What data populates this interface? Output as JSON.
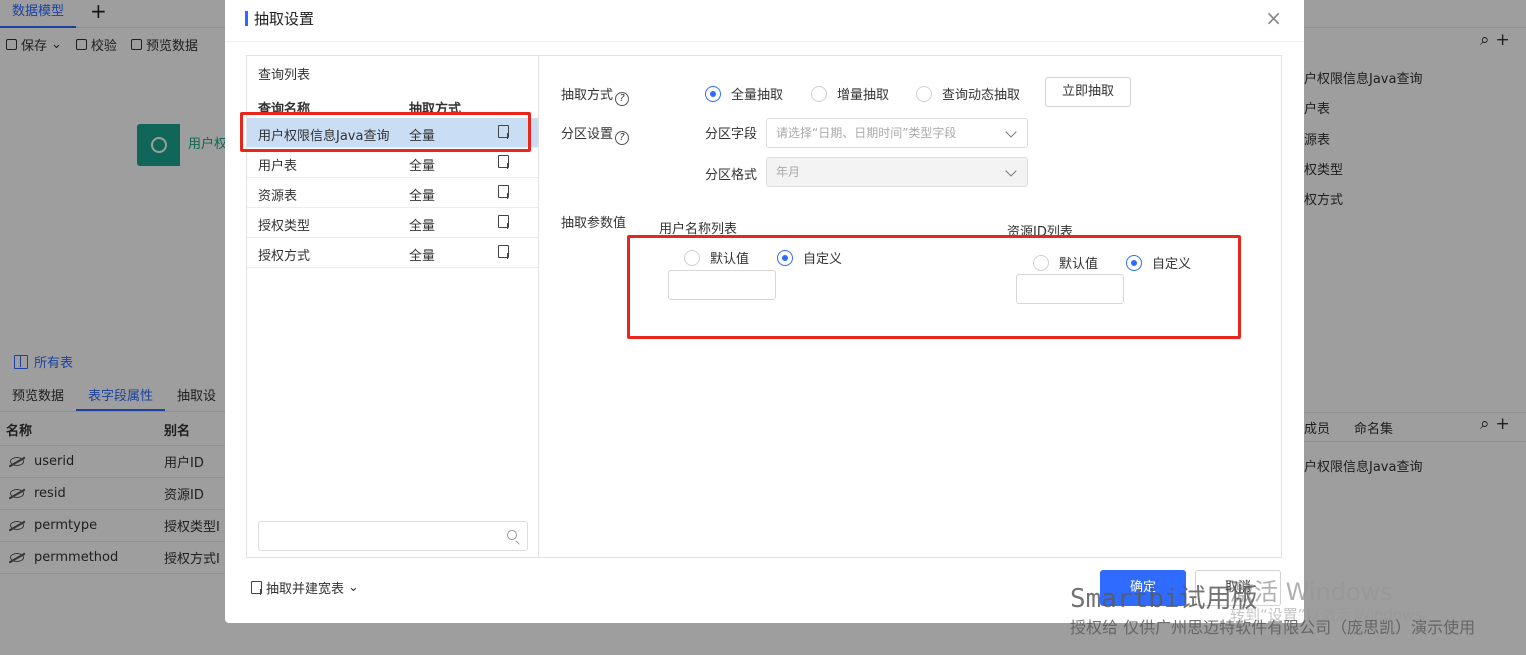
{
  "app": {
    "tab_active": "数据模型",
    "tab_add": "+",
    "toolbar": {
      "save": "保存",
      "validate": "校验",
      "preview": "预览数据"
    },
    "node_label": "用户权",
    "all_tables": "所有表",
    "bottom_tabs": [
      "预览数据",
      "表字段属性",
      "抽取设"
    ],
    "field_table": {
      "headers": [
        "名称",
        "别名"
      ],
      "rows": [
        {
          "name": "userid",
          "alias": "用户ID"
        },
        {
          "name": "resid",
          "alias": "资源ID"
        },
        {
          "name": "permtype",
          "alias": "授权类型I"
        },
        {
          "name": "permmethod",
          "alias": "授权方式I"
        }
      ]
    },
    "right_list": [
      "户权限信息Java查询",
      "户表",
      "源表",
      "权类型",
      "权方式"
    ],
    "right_tabs": [
      "成员",
      "命名集"
    ],
    "right_bottom_item": "户权限信息Java查询",
    "icons": {
      "search": "search-icon",
      "add": "plus-icon"
    }
  },
  "dialog": {
    "title": "抽取设置",
    "close": "×",
    "query_list": {
      "title": "查询列表",
      "headers": [
        "查询名称",
        "抽取方式"
      ],
      "rows": [
        {
          "name": "用户权限信息Java查询",
          "mode": "全量",
          "selected": true
        },
        {
          "name": "用户表",
          "mode": "全量"
        },
        {
          "name": "资源表",
          "mode": "全量"
        },
        {
          "name": "授权类型",
          "mode": "全量"
        },
        {
          "name": "授权方式",
          "mode": "全量"
        }
      ],
      "search_placeholder": ""
    },
    "settings": {
      "extract_mode_label": "抽取方式",
      "extract_modes": [
        "全量抽取",
        "增量抽取",
        "查询动态抽取"
      ],
      "extract_mode_selected": "全量抽取",
      "extract_now": "立即抽取",
      "partition_label": "分区设置",
      "partition_field_label": "分区字段",
      "partition_field_placeholder": "请选择“日期、日期时间”类型字段",
      "partition_format_label": "分区格式",
      "partition_format_value": "年月",
      "params_label": "抽取参数值",
      "param1": {
        "label": "用户名称列表",
        "options": [
          "默认值",
          "自定义"
        ],
        "selected": "自定义",
        "value": ""
      },
      "param2": {
        "label": "资源ID列表",
        "options": [
          "默认值",
          "自定义"
        ],
        "selected": "自定义",
        "value": ""
      }
    },
    "footer": {
      "extract_and_wide": "抽取并建宽表",
      "ok": "确定",
      "cancel": "取消"
    }
  },
  "watermarks": {
    "windows_line1": "激活 Windows",
    "windows_line2": "转到“设置”以激活 Windows。",
    "smartbi_line1": "Smartbi试用版",
    "smartbi_line2": "授权给 仅供广州思迈特软件有限公司（庞思凯）演示使用"
  },
  "colors": {
    "accent": "#2f6bff",
    "node": "#1aa58e",
    "highlight": "#e8261c",
    "selected_row": "#c9ddf5"
  }
}
